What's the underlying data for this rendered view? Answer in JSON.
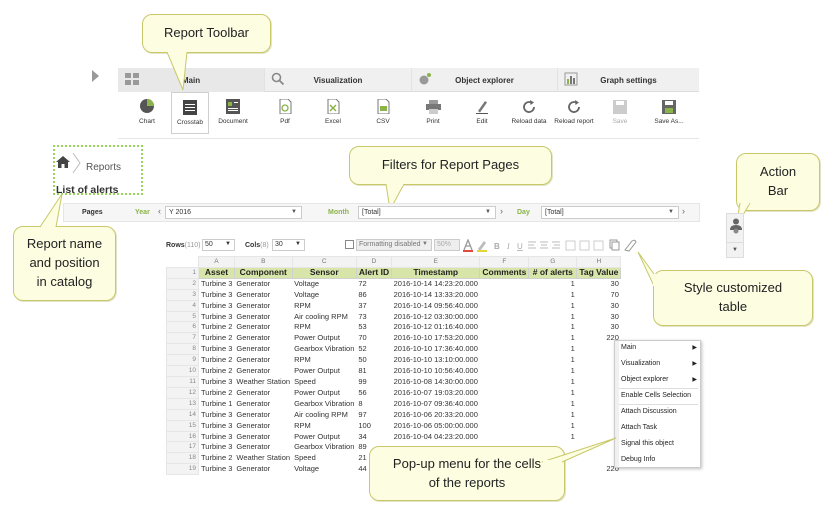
{
  "callouts": {
    "toolbar": "Report Toolbar",
    "filters": "Filters for Report Pages",
    "action_bar_1": "Action",
    "action_bar_2": "Bar",
    "report_name_1": "Report name",
    "report_name_2": "and position",
    "report_name_3": "in catalog",
    "style_1": "Style customized",
    "style_2": "table",
    "popup_1": "Pop-up menu for the cells",
    "popup_2": "of the reports"
  },
  "tabs": [
    {
      "label": "Main",
      "icon": "grid-icon"
    },
    {
      "label": "Visualization",
      "icon": "magnifier-icon"
    },
    {
      "label": "Object explorer",
      "icon": "object-icon"
    },
    {
      "label": "Graph settings",
      "icon": "chart-icon"
    }
  ],
  "toolbar_buttons": [
    "Chart",
    "Crosstab",
    "Document",
    "Pdf",
    "Excel",
    "CSV",
    "Print",
    "Edit",
    "Reload data",
    "Reload report",
    "Save",
    "Save As..."
  ],
  "breadcrumb": {
    "label": "Reports",
    "title": "List of alerts"
  },
  "filters": {
    "pages_label": "Pages",
    "year_label": "Year",
    "year_value": "Y 2016",
    "month_label": "Month",
    "month_value": "[Total]",
    "day_label": "Day",
    "day_value": "[Total]"
  },
  "format_bar": {
    "rows_label": "Rows",
    "rows_count": "(110)",
    "rows_value": "50",
    "cols_label": "Cols",
    "cols_count": "(8)",
    "cols_value": "30",
    "formatting": "Formatting disabled",
    "size": "50%"
  },
  "table": {
    "col_letters": [
      "A",
      "B",
      "C",
      "D",
      "E",
      "F",
      "G",
      "H"
    ],
    "headers": [
      "Asset",
      "Component",
      "Sensor",
      "Alert ID",
      "Timestamp",
      "Comments",
      "# of alerts",
      "Tag Value"
    ],
    "rows": [
      [
        "2",
        "Turbine 3",
        "Generator",
        "Voltage",
        "72",
        "2016-10-14 14:23:20.000",
        "",
        "1",
        "30"
      ],
      [
        "3",
        "Turbine 3",
        "Generator",
        "Voltage",
        "86",
        "2016-10-14 13:33:20.000",
        "",
        "1",
        "70"
      ],
      [
        "4",
        "Turbine 3",
        "Generator",
        "RPM",
        "37",
        "2016-10-14 09:56:40.000",
        "",
        "1",
        "30"
      ],
      [
        "5",
        "Turbine 3",
        "Generator",
        "Air cooling RPM",
        "73",
        "2016-10-12 03:30:00.000",
        "",
        "1",
        "30"
      ],
      [
        "6",
        "Turbine 2",
        "Generator",
        "RPM",
        "53",
        "2016-10-12 01:16:40.000",
        "",
        "1",
        "30"
      ],
      [
        "7",
        "Turbine 2",
        "Generator",
        "Power Output",
        "70",
        "2016-10-10 17:53:20.000",
        "",
        "1",
        "220"
      ],
      [
        "8",
        "Turbine 3",
        "Generator",
        "Gearbox Vibration",
        "52",
        "2016-10-10 17:36:40.000",
        "",
        "1",
        ""
      ],
      [
        "9",
        "Turbine 2",
        "Generator",
        "RPM",
        "50",
        "2016-10-10 13:10:00.000",
        "",
        "1",
        ""
      ],
      [
        "10",
        "Turbine 2",
        "Generator",
        "Power Output",
        "81",
        "2016-10-10 10:56:40.000",
        "",
        "1",
        ""
      ],
      [
        "11",
        "Turbine 3",
        "Weather Station",
        "Speed",
        "99",
        "2016-10-08 14:30:00.000",
        "",
        "1",
        ""
      ],
      [
        "12",
        "Turbine 2",
        "Generator",
        "Power Output",
        "56",
        "2016-10-07 19:03:20.000",
        "",
        "1",
        ""
      ],
      [
        "13",
        "Turbine 1",
        "Generator",
        "Gearbox Vibration",
        "8",
        "2016-10-07 09:36:40.000",
        "",
        "1",
        ""
      ],
      [
        "14",
        "Turbine 3",
        "Generator",
        "Air cooling RPM",
        "97",
        "2016-10-06 20:33:20.000",
        "",
        "1",
        ""
      ],
      [
        "15",
        "Turbine 3",
        "Generator",
        "RPM",
        "100",
        "2016-10-06 05:00:00.000",
        "",
        "1",
        ""
      ],
      [
        "16",
        "Turbine 3",
        "Generator",
        "Power Output",
        "34",
        "2016-10-04 04:23:20.000",
        "",
        "1",
        ""
      ],
      [
        "17",
        "Turbine 3",
        "Generator",
        "Gearbox Vibration",
        "89",
        "",
        "",
        "",
        ""
      ],
      [
        "18",
        "Turbine 2",
        "Weather Station",
        "Speed",
        "21",
        "",
        "",
        "",
        ""
      ],
      [
        "19",
        "Turbine 3",
        "Generator",
        "Voltage",
        "44",
        "",
        "",
        "",
        "220"
      ]
    ]
  },
  "popup_menu": [
    "Main",
    "Visualization",
    "Object explorer",
    "Enable Cells Selection",
    "Attach Discussion",
    "Attach Task",
    "Signal this object",
    "Debug Info"
  ]
}
